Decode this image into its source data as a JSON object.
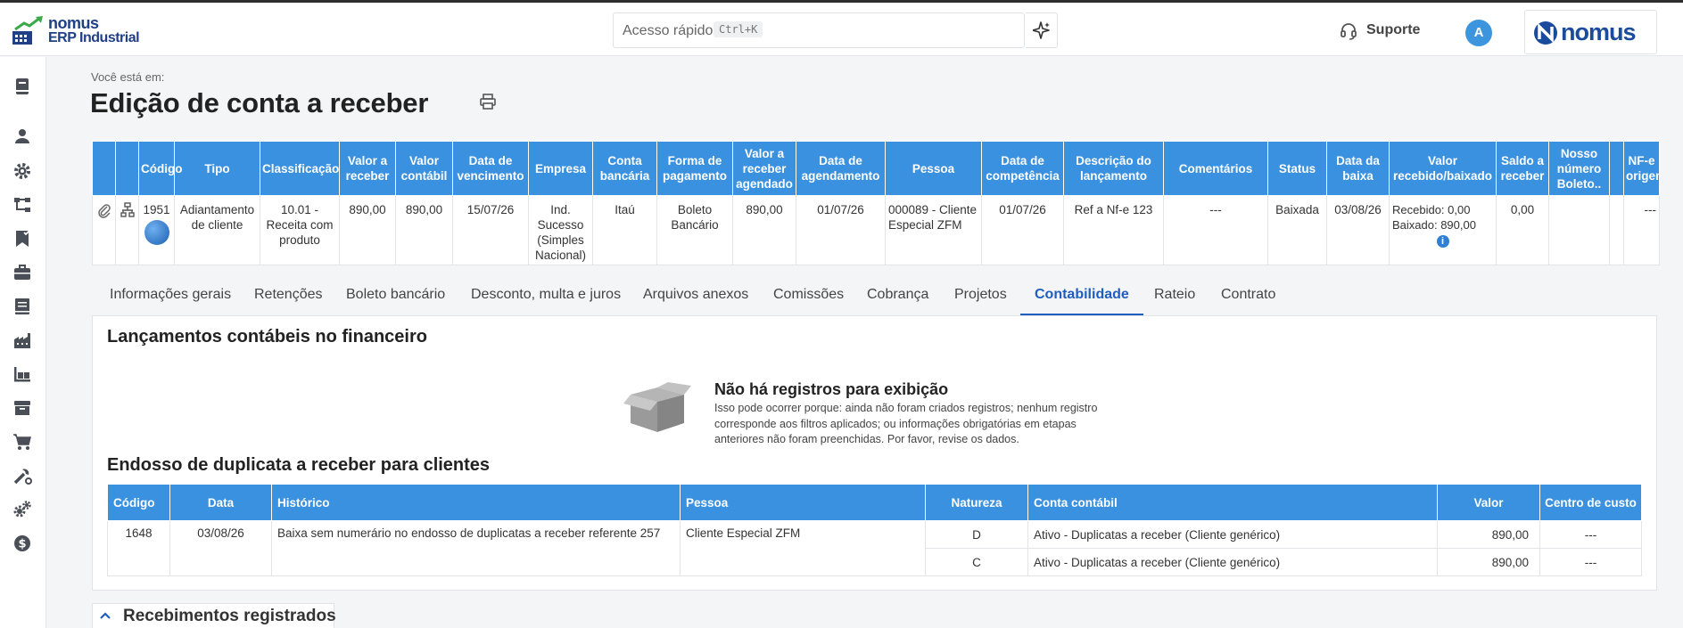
{
  "header": {
    "logo_line1": "nomus",
    "logo_line2": "ERP Industrial",
    "search_placeholder": "Acesso rápido",
    "search_shortcut": "Ctrl+K",
    "support_label": "Suporte",
    "avatar_initial": "A",
    "brand_text": "nomus"
  },
  "sidebar": {
    "icons": [
      "book-icon",
      "user-icon",
      "gear-icon",
      "hierarchy-icon",
      "bookmark-check-icon",
      "briefcase-icon",
      "ledger-icon",
      "factory-icon",
      "warehouse-icon",
      "archive-icon",
      "cart-icon",
      "tools-icon",
      "cogs-icon",
      "dollar-icon"
    ]
  },
  "breadcrumb": "Você está em:",
  "page_title": "Edição de conta a receber",
  "grid": {
    "headers": [
      "",
      "",
      "Código",
      "Tipo",
      "Classificação",
      "Valor a receber",
      "Valor contábil",
      "Data de vencimento",
      "Empresa",
      "Conta bancária",
      "Forma de pagamento",
      "Valor a receber agendado",
      "Data de agendamento",
      "Pessoa",
      "Data de competência",
      "Descrição do lançamento",
      "Comentários",
      "Status",
      "Data da baixa",
      "Valor recebido/baixado",
      "Saldo a receber",
      "Nosso número Boleto..",
      "",
      "NF-e origem"
    ],
    "row": {
      "codigo": "1951",
      "tipo": "Adiantamento de cliente",
      "classificacao": "10.01 - Receita com produto",
      "valor_receber": "890,00",
      "valor_contabil": "890,00",
      "data_vencimento": "15/07/26",
      "empresa": "Ind. Sucesso (Simples Nacional)",
      "conta_bancaria": "Itaú",
      "forma_pagamento": "Boleto Bancário",
      "valor_agendado": "890,00",
      "data_agendamento": "01/07/26",
      "pessoa": "000089 - Cliente Especial ZFM",
      "data_competencia": "01/07/26",
      "descricao": "Ref a Nf-e 123",
      "comentarios": "---",
      "status": "Baixada",
      "data_baixa": "03/08/26",
      "recebido": "Recebido: 0,00",
      "baixado": "Baixado: 890,00",
      "saldo": "0,00",
      "nosso_numero": "",
      "nfe_origem": "---"
    }
  },
  "tabs": [
    {
      "label": "Informações gerais"
    },
    {
      "label": "Retenções"
    },
    {
      "label": "Boleto bancário"
    },
    {
      "label": "Desconto, multa e juros"
    },
    {
      "label": "Arquivos anexos"
    },
    {
      "label": "Comissões"
    },
    {
      "label": "Cobrança"
    },
    {
      "label": "Projetos"
    },
    {
      "label": "Contabilidade",
      "active": true
    },
    {
      "label": "Rateio"
    },
    {
      "label": "Contrato"
    }
  ],
  "contabilidade": {
    "section1_title": "Lançamentos contábeis no financeiro",
    "empty_title": "Não há registros para exibição",
    "empty_desc": "Isso pode ocorrer porque: ainda não foram criados registros; nenhum registro corresponde aos filtros aplicados; ou informações obrigatórias em etapas anteriores não foram preenchidas. Por favor, revise os dados.",
    "section2_title": "Endosso de duplicata a receber para clientes",
    "table": {
      "headers": [
        "Código",
        "Data",
        "Histórico",
        "Pessoa",
        "Natureza",
        "Conta contábil",
        "Valor",
        "Centro de custo"
      ],
      "codigo": "1648",
      "data": "03/08/26",
      "historico": "Baixa sem numerário no endosso de duplicatas a receber referente 257",
      "pessoa": "Cliente Especial ZFM",
      "lines": [
        {
          "natureza": "D",
          "conta": "Ativo - Duplicatas a receber (Cliente genérico)",
          "valor": "890,00",
          "centro": "---"
        },
        {
          "natureza": "C",
          "conta": "Ativo - Duplicatas a receber (Cliente genérico)",
          "valor": "890,00",
          "centro": "---"
        }
      ]
    }
  },
  "recebimentos_title": "Recebimentos registrados",
  "colors": {
    "header_blue": "#3a91df",
    "active_tab": "#1f5dbf",
    "brand_navy": "#1f3f86"
  }
}
